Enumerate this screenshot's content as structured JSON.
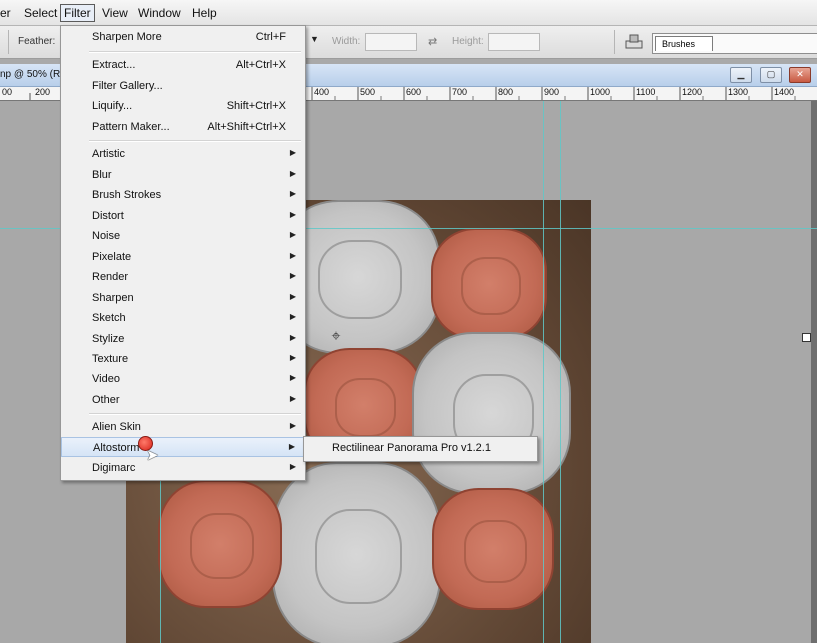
{
  "menubar": {
    "items": [
      "er",
      "Select",
      "Filter",
      "View",
      "Window",
      "Help"
    ],
    "active": "Filter"
  },
  "options": {
    "feather_label": "Feather:",
    "width_label": "Width:",
    "height_label": "Height:",
    "brushes_tab": "Brushes"
  },
  "document": {
    "title_fragment": "np @ 50% (R"
  },
  "ruler": {
    "labels": [
      "00",
      "200",
      "400",
      "500",
      "600",
      "700",
      "800",
      "900",
      "1000",
      "1100",
      "1200",
      "1300",
      "1400"
    ]
  },
  "filter_menu": {
    "group1": [
      {
        "label": "Sharpen More",
        "shortcut": "Ctrl+F"
      }
    ],
    "group2": [
      {
        "label": "Extract...",
        "shortcut": "Alt+Ctrl+X"
      },
      {
        "label": "Filter Gallery...",
        "shortcut": ""
      },
      {
        "label": "Liquify...",
        "shortcut": "Shift+Ctrl+X"
      },
      {
        "label": "Pattern Maker...",
        "shortcut": "Alt+Shift+Ctrl+X"
      }
    ],
    "group3": [
      "Artistic",
      "Blur",
      "Brush Strokes",
      "Distort",
      "Noise",
      "Pixelate",
      "Render",
      "Sharpen",
      "Sketch",
      "Stylize",
      "Texture",
      "Video",
      "Other"
    ],
    "group4": [
      "Alien Skin",
      "Altostorm",
      "Digimarc"
    ],
    "highlighted": "Altostorm"
  },
  "submenu": {
    "item": "Rectilinear Panorama Pro v1.2.1"
  },
  "colors": {
    "menu_highlight": "#d5e4f6",
    "guide": "#5fc8c8",
    "close_button": "#c85a42"
  }
}
